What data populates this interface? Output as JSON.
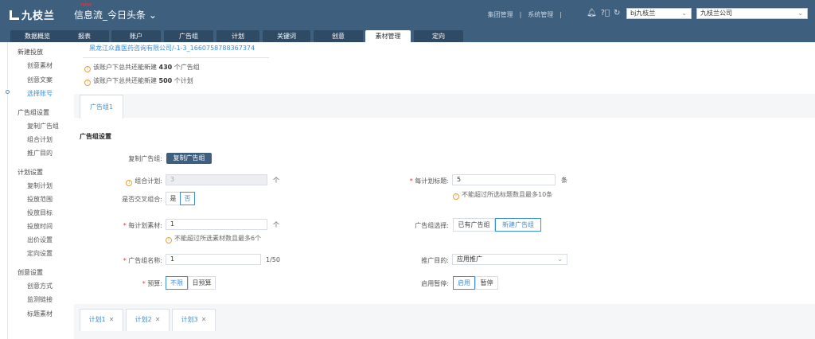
{
  "header": {
    "logo": "九枝兰",
    "new_badge": "new",
    "product": "信息流_今日头条",
    "links": [
      "集团管理",
      "|",
      "系统管理",
      "|"
    ],
    "account_select": "bj九枝兰",
    "company_select": "九枝兰公司"
  },
  "tabs": [
    "数据概览",
    "报表",
    "账户",
    "广告组",
    "计划",
    "关键词",
    "创意",
    "素材管理",
    "定向"
  ],
  "active_tab": "素材管理",
  "sidebar": {
    "groups": [
      {
        "title": "新建投放",
        "items": [
          "创意素材",
          "创意文案",
          "选择账号"
        ]
      },
      {
        "title": "广告组设置",
        "items": [
          "复制广告组",
          "组合计划",
          "推广目的"
        ]
      },
      {
        "title": "计划设置",
        "items": [
          "复制计划",
          "投放范围",
          "投放目标",
          "投放时间",
          "出价设置",
          "定向设置"
        ]
      },
      {
        "title": "创意设置",
        "items": [
          "创意方式",
          "监测链接",
          "标题素材"
        ]
      }
    ],
    "active_item": "选择账号"
  },
  "account": {
    "name": "黑龙江众鑫医药咨询有限公司/-1-3_1660758788367374",
    "notice1_pre": "该账户下总共还能新建 ",
    "notice1_num": "430",
    "notice1_post": " 个广告组",
    "notice2_pre": "该账户下总共还能新建 ",
    "notice2_num": "500",
    "notice2_post": " 个计划"
  },
  "adgroup_tab": "广告组1",
  "section_title": "广告组设置",
  "form": {
    "copy_label": "复制广告组:",
    "copy_button": "复制广告组",
    "combo_label": "组合计划:",
    "combo_value": "3",
    "combo_unit": "个",
    "cross_label": "是否交叉组合:",
    "cross_yes": "是",
    "cross_no": "否",
    "material_label": "每计划素材:",
    "material_value": "1",
    "material_unit": "个",
    "material_hint": "不能超过所选素材数且最多6个",
    "name_label": "广告组名称:",
    "name_value": "1",
    "name_count": "1/50",
    "budget_label": "预算:",
    "budget_unlimited": "不限",
    "budget_daily": "日预算",
    "title_label": "每计划标题:",
    "title_value": "5",
    "title_unit": "条",
    "title_hint": "不能超过所选标题数且最多10条",
    "select_label": "广告组选择:",
    "select_existing": "已有广告组",
    "select_new": "新建广告组",
    "purpose_label": "推广目的:",
    "purpose_value": "应用推广",
    "status_label": "启用暂停:",
    "status_on": "启用",
    "status_off": "暂停"
  },
  "plan_tabs": [
    "计划1",
    "计划2",
    "计划3"
  ]
}
